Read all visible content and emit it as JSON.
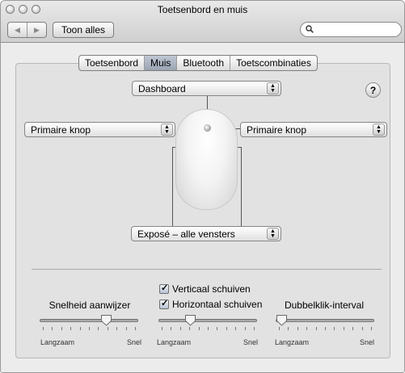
{
  "window": {
    "title": "Toetsenbord en muis"
  },
  "toolbar": {
    "back_label": "◀",
    "forward_label": "▶",
    "show_all_label": "Toon alles",
    "search_placeholder": ""
  },
  "tabs": [
    {
      "label": "Toetsenbord",
      "active": false
    },
    {
      "label": "Muis",
      "active": true
    },
    {
      "label": "Bluetooth",
      "active": false
    },
    {
      "label": "Toetscombinaties",
      "active": false
    }
  ],
  "mouse": {
    "top_action": "Dashboard",
    "left_action": "Primaire knop",
    "right_action": "Primaire knop",
    "bottom_action": "Exposé – alle vensters",
    "help_label": "?"
  },
  "scrolling": {
    "vertical": {
      "label": "Verticaal schuiven",
      "checked": true
    },
    "horizontal": {
      "label": "Horizontaal schuiven",
      "checked": true
    }
  },
  "sliders": [
    {
      "label": "Snelheid aanwijzer",
      "min_label": "Langzaam",
      "max_label": "Snel",
      "value": 0.7
    },
    {
      "label": "",
      "min_label": "Langzaam",
      "max_label": "Snel",
      "value": 0.3
    },
    {
      "label": "Dubbelklik-interval",
      "min_label": "Langzaam",
      "max_label": "Snel",
      "value": 0.0
    }
  ]
}
